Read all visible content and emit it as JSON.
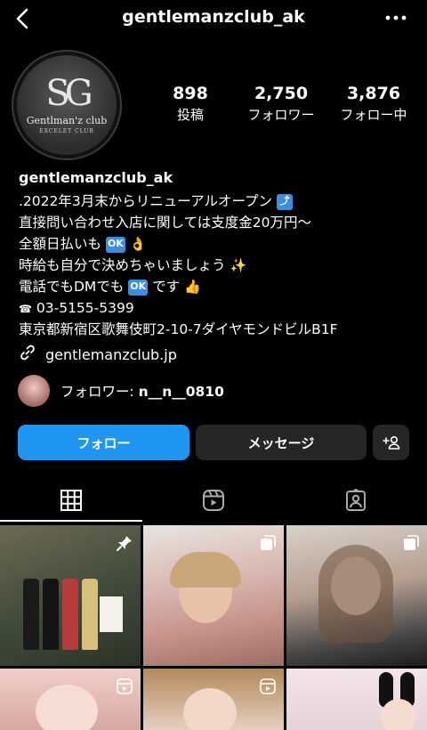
{
  "header": {
    "username": "gentlemanzclub_ak"
  },
  "profile": {
    "logo_text": "Gentlman'z club",
    "logo_subtext": "EXCELET CLUB",
    "logo_mark": "SG"
  },
  "stats": {
    "posts": {
      "value": "898",
      "label": "投稿"
    },
    "followers": {
      "value": "2,750",
      "label": "フォロワー"
    },
    "following": {
      "value": "3,876",
      "label": "フォロー中"
    }
  },
  "bio": {
    "name": "gentlemanzclub_ak",
    "lines": [
      ".2022年3月末からリニューアルオープン",
      "直接問い合わせ入店に関しては支度金20万円〜",
      "全額日払いも",
      "時給も自分で決めちゃいましょう",
      "電話でもDMでも",
      "です",
      "03-5155-5399",
      "東京都新宿区歌舞伎町2-10-7ダイヤモンドビルB1F"
    ],
    "ok_badge": "OK",
    "phone_icon": "☎"
  },
  "link": {
    "text": "gentlemanzclub.jp"
  },
  "followed_by": {
    "prefix": "フォロワー: ",
    "name": "n__n__0810"
  },
  "buttons": {
    "follow": "フォロー",
    "message": "メッセージ"
  },
  "tabs": [
    {
      "name": "grid",
      "icon": "grid-icon",
      "active": true
    },
    {
      "name": "reels",
      "icon": "reels-icon",
      "active": false
    },
    {
      "name": "tagged",
      "icon": "tagged-icon",
      "active": false
    }
  ],
  "colors": {
    "follow_button": "#2096f3",
    "secondary_button": "#262626",
    "background": "#000000"
  }
}
